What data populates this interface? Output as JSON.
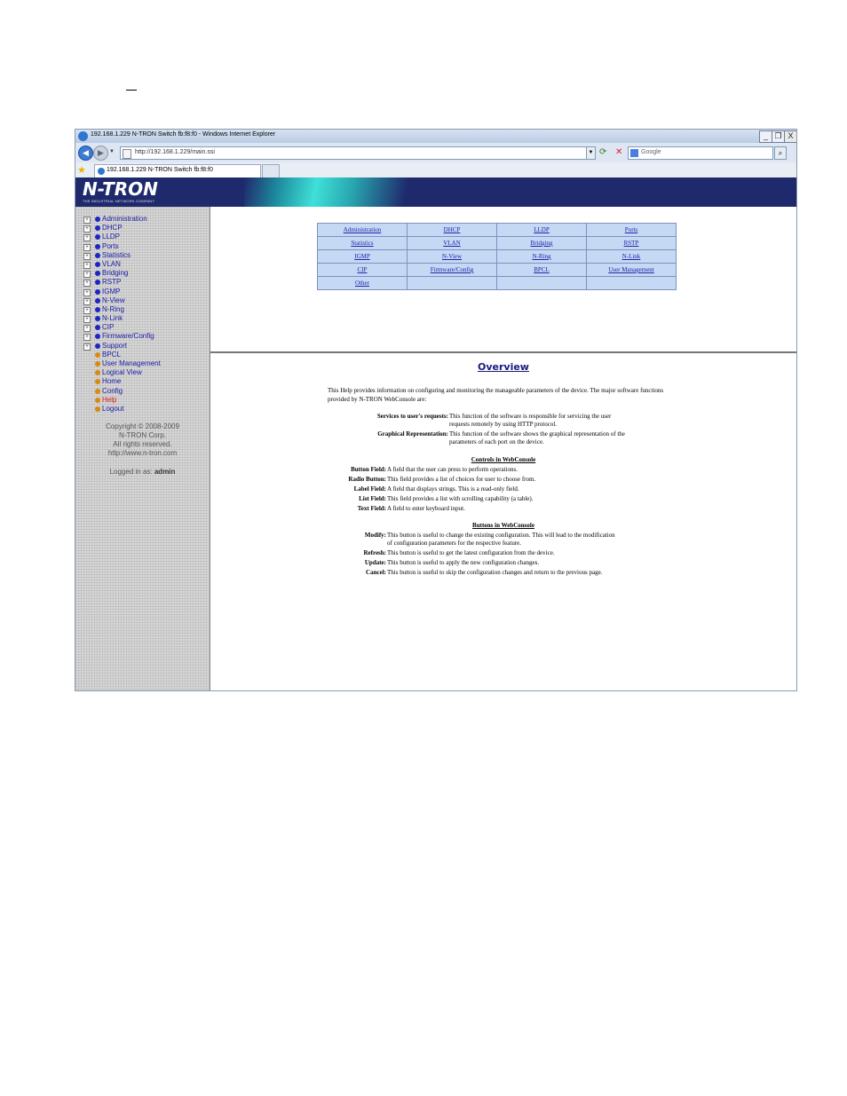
{
  "window": {
    "title": "192.168.1.229 N-TRON Switch fb:f8:f0 - Windows Internet Explorer",
    "buttons": {
      "minimize": "_",
      "restore": "❐",
      "close": "X"
    }
  },
  "address_bar": {
    "url": "http://192.168.1.229/main.ssi",
    "search_placeholder": "Google"
  },
  "tab": {
    "label": "192.168.1.229 N-TRON Switch fb:f8:f0"
  },
  "banner": {
    "logo_text": "N-TRON",
    "tagline": "THE INDUSTRIAL NETWORK COMPANY"
  },
  "sidebar": {
    "items": [
      {
        "label": "Administration",
        "expandable": true
      },
      {
        "label": "DHCP",
        "expandable": true
      },
      {
        "label": "LLDP",
        "expandable": true
      },
      {
        "label": "Ports",
        "expandable": true
      },
      {
        "label": "Statistics",
        "expandable": true
      },
      {
        "label": "VLAN",
        "expandable": true
      },
      {
        "label": "Bridging",
        "expandable": true
      },
      {
        "label": "RSTP",
        "expandable": true
      },
      {
        "label": "IGMP",
        "expandable": true
      },
      {
        "label": "N-View",
        "expandable": true
      },
      {
        "label": "N-Ring",
        "expandable": true
      },
      {
        "label": "N-Link",
        "expandable": true
      },
      {
        "label": "CIP",
        "expandable": true
      },
      {
        "label": "Firmware/Config",
        "expandable": true
      },
      {
        "label": "Support",
        "expandable": true
      },
      {
        "label": "BPCL",
        "expandable": false
      },
      {
        "label": "User Management",
        "expandable": false
      },
      {
        "label": "Logical View",
        "expandable": false
      },
      {
        "label": "Home",
        "expandable": false
      },
      {
        "label": "Config",
        "expandable": false
      },
      {
        "label": "Help",
        "expandable": false
      },
      {
        "label": "Logout",
        "expandable": false
      }
    ],
    "copyright": [
      "Copyright © 2008-2009",
      "N-TRON Corp.",
      "All rights reserved.",
      "http://www.n-tron.com"
    ],
    "logged_in_label": "Logged in as:",
    "logged_in_user": "admin"
  },
  "link_table": [
    [
      "Administration",
      "DHCP",
      "LLDP",
      "Ports"
    ],
    [
      "Statistics",
      "VLAN",
      "Bridging",
      "RSTP"
    ],
    [
      "IGMP",
      "N-View",
      "N-Ring",
      "N-Link"
    ],
    [
      "CIP",
      "Firmware/Config",
      "BPCL",
      "User Management"
    ],
    [
      "Other",
      "",
      "",
      ""
    ]
  ],
  "help": {
    "title": "Overview",
    "intro": "This Help provides information on configuring and monitoring the manageable parameters of the device. The major software functions provided by N-TRON WebConsole are:",
    "functions": [
      {
        "term": "Services to user's requests:",
        "lines": [
          "This function of the software is responsible for servicing the user",
          "requests remotely by using HTTP protocol."
        ]
      },
      {
        "term": "Graphical Representation:",
        "lines": [
          "This function of the software shows the graphical representation of the",
          "parameters of each port on the device."
        ]
      }
    ],
    "controls_title": "Controls in WebConsole",
    "controls": [
      {
        "term": "Button Field:",
        "desc": "A field that the user can press to perform operations."
      },
      {
        "term": "Radio Button:",
        "desc": "This field provides a list of choices for user to choose from."
      },
      {
        "term": "Label Field:",
        "desc": "A field that displays strings. This is a read-only field."
      },
      {
        "term": "List Field:",
        "desc": "This field provides a list with scrolling capability (a table)."
      },
      {
        "term": "Text Field:",
        "desc": "A field to enter keyboard input."
      }
    ],
    "buttons_title": "Buttons in WebConsole",
    "buttons": [
      {
        "term": "Modify:",
        "lines": [
          "This button is useful to change the existing configuration. This will lead to the modification",
          "of configuration parameters for the respective feature."
        ]
      },
      {
        "term": "Refresh:",
        "lines": [
          "This button is useful to get the latest configuration from the device."
        ]
      },
      {
        "term": "Update:",
        "lines": [
          "This button is useful to apply the new configuration changes."
        ]
      },
      {
        "term": "Cancel:",
        "lines": [
          "This button is useful to skip the configuration changes and return to the previous page."
        ]
      }
    ]
  }
}
